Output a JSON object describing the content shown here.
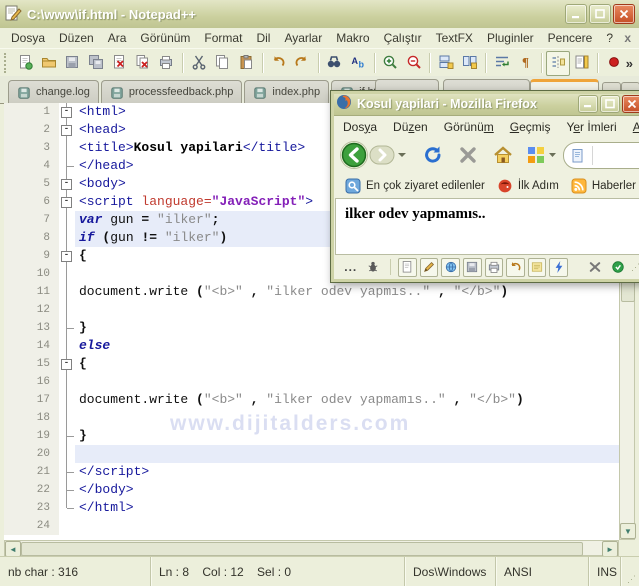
{
  "npp": {
    "title": "C:\\www\\if.html - Notepad++",
    "menu": [
      "Dosya",
      "Düzen",
      "Ara",
      "Görünüm",
      "Format",
      "Dil",
      "Ayarlar",
      "Makro",
      "Çalıştır",
      "TextFX",
      "Pluginler",
      "Pencere",
      "?"
    ],
    "menu_close_label": "x",
    "toolbar_icons": [
      "new-file",
      "open-folder",
      "save",
      "save-all",
      "close",
      "close-all",
      "print",
      "sep",
      "cut",
      "copy",
      "paste",
      "sep",
      "undo",
      "redo",
      "sep",
      "find",
      "replace",
      "sep",
      "zoom-in",
      "zoom-out",
      "sep",
      "sync-vertical",
      "sync-horizontal",
      "sep",
      "word-wrap",
      "show-all-chars",
      "sep",
      "indent-guide",
      "doc-map",
      "sep",
      "record-macro"
    ],
    "toolbar_overflow_label": "»",
    "tabs": [
      "change.log",
      "processfeedback.php",
      "index.php",
      "if.html"
    ],
    "editor": {
      "watermark": "www.dijitalders.com",
      "lines": [
        {
          "n": 1,
          "f": "box",
          "hl": false,
          "s": [
            [
              "tag",
              "<html>"
            ]
          ]
        },
        {
          "n": 2,
          "f": "box",
          "hl": false,
          "s": [
            [
              "tag",
              "<head>"
            ]
          ]
        },
        {
          "n": 3,
          "f": "line",
          "hl": false,
          "s": [
            [
              "tag",
              "<title>"
            ],
            [
              "b",
              "Kosul yapilari"
            ],
            [
              "tag",
              "</title>"
            ]
          ]
        },
        {
          "n": 4,
          "f": "tick",
          "hl": false,
          "s": [
            [
              "tag",
              "</head>"
            ]
          ]
        },
        {
          "n": 5,
          "f": "box",
          "hl": false,
          "s": [
            [
              "tag",
              "<body>"
            ]
          ]
        },
        {
          "n": 6,
          "f": "box",
          "hl": false,
          "s": [
            [
              "tag",
              "<script "
            ],
            [
              "attr",
              "language="
            ],
            [
              "aval",
              "\"JavaScript\""
            ],
            [
              "tag",
              ">"
            ]
          ]
        },
        {
          "n": 7,
          "f": "line",
          "hl": true,
          "s": [
            [
              "kw",
              "var"
            ],
            [
              "pl",
              " gun "
            ],
            [
              "op",
              "="
            ],
            [
              "pl",
              " "
            ],
            [
              "str",
              "\"ilker\""
            ],
            [
              "op",
              ";"
            ]
          ]
        },
        {
          "n": 8,
          "f": "line",
          "hl": true,
          "s": [
            [
              "kw",
              "if"
            ],
            [
              "pl",
              " "
            ],
            [
              "op",
              "("
            ],
            [
              "pl",
              "gun "
            ],
            [
              "op",
              "!="
            ],
            [
              "pl",
              " "
            ],
            [
              "str",
              "\"ilker\""
            ],
            [
              "op",
              ")"
            ]
          ]
        },
        {
          "n": 9,
          "f": "box",
          "hl": false,
          "s": [
            [
              "op",
              "{"
            ]
          ]
        },
        {
          "n": 10,
          "f": "line",
          "hl": false,
          "s": []
        },
        {
          "n": 11,
          "f": "line",
          "hl": false,
          "s": [
            [
              "pl",
              "document.write "
            ],
            [
              "op",
              "("
            ],
            [
              "str",
              "\"<b>\""
            ],
            [
              "pl",
              " "
            ],
            [
              "op",
              ","
            ],
            [
              "pl",
              " "
            ],
            [
              "str",
              "\"ilker odev yapmıs..\""
            ],
            [
              "pl",
              " "
            ],
            [
              "op",
              ","
            ],
            [
              "pl",
              " "
            ],
            [
              "str",
              "\"</b>\""
            ],
            [
              "op",
              ")"
            ]
          ]
        },
        {
          "n": 12,
          "f": "line",
          "hl": false,
          "s": []
        },
        {
          "n": 13,
          "f": "tick",
          "hl": false,
          "s": [
            [
              "op",
              "}"
            ]
          ]
        },
        {
          "n": 14,
          "f": "line",
          "hl": false,
          "s": [
            [
              "kw",
              "else"
            ]
          ]
        },
        {
          "n": 15,
          "f": "box",
          "hl": false,
          "s": [
            [
              "op",
              "{"
            ]
          ]
        },
        {
          "n": 16,
          "f": "line",
          "hl": false,
          "s": []
        },
        {
          "n": 17,
          "f": "line",
          "hl": false,
          "s": [
            [
              "pl",
              "document.write "
            ],
            [
              "op",
              "("
            ],
            [
              "str",
              "\"<b>\""
            ],
            [
              "pl",
              " "
            ],
            [
              "op",
              ","
            ],
            [
              "pl",
              " "
            ],
            [
              "str",
              "\"ilker odev yapmamıs..\""
            ],
            [
              "pl",
              " "
            ],
            [
              "op",
              ","
            ],
            [
              "pl",
              " "
            ],
            [
              "str",
              "\"</b>\""
            ],
            [
              "op",
              ")"
            ]
          ]
        },
        {
          "n": 18,
          "f": "line",
          "hl": false,
          "s": []
        },
        {
          "n": 19,
          "f": "tick",
          "hl": false,
          "s": [
            [
              "op",
              "}"
            ]
          ]
        },
        {
          "n": 20,
          "f": "line",
          "hl": true,
          "s": []
        },
        {
          "n": 21,
          "f": "tick",
          "hl": false,
          "s": [
            [
              "tag",
              "</script>"
            ]
          ]
        },
        {
          "n": 22,
          "f": "tick",
          "hl": false,
          "s": [
            [
              "tag",
              "</body>"
            ]
          ]
        },
        {
          "n": 23,
          "f": "tickend",
          "hl": false,
          "s": [
            [
              "tag",
              "</html>"
            ]
          ]
        },
        {
          "n": 24,
          "f": "none",
          "hl": false,
          "s": []
        }
      ]
    },
    "statusbar": {
      "chars": "nb char : 316",
      "position": "Ln : 8    Col : 12    Sel : 0",
      "eol": "Dos\\Windows",
      "encoding": "ANSI",
      "mode": "INS"
    }
  },
  "firefox": {
    "title": "Kosul yapilari - Mozilla Firefox",
    "menu": [
      {
        "label": "Dosya",
        "key": "y"
      },
      {
        "label": "Düzen",
        "key": "z"
      },
      {
        "label": "Görünüm",
        "key": "m"
      },
      {
        "label": "Geçmiş",
        "key": "G"
      },
      {
        "label": "Yer İmleri",
        "key": "e"
      },
      {
        "label": "Araçlar",
        "key": "A"
      }
    ],
    "bookmarks": [
      {
        "icon": "most-visited",
        "label": "En çok ziyaret edilenler"
      },
      {
        "icon": "getting-started",
        "label": "İlk Adım"
      },
      {
        "icon": "rss",
        "label": "Haberler"
      }
    ],
    "content_text": "ilker odev yapmamıs..",
    "status_left_icons": [
      "ellipsis",
      "firebug",
      "sep",
      "new-doc",
      "edit",
      "globe",
      "save",
      "print",
      "undo",
      "note",
      "lightning"
    ],
    "status_right_icons": [
      "tools",
      "info"
    ]
  },
  "colors": {
    "titlebar_olive": "#CBD09E",
    "active_tab_accent": "#EFA43A",
    "line_highlight": "#E7ECF9",
    "back_button_green": "#3DA03D",
    "close_button_red": "#C54E26"
  }
}
